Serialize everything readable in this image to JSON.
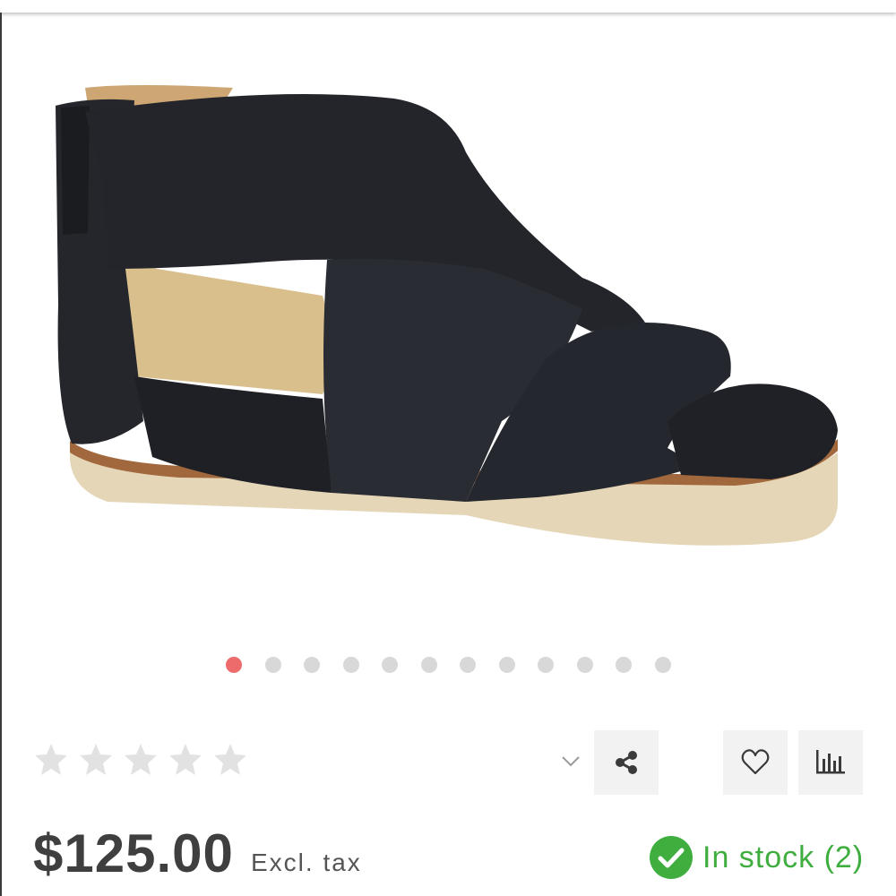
{
  "gallery": {
    "image_alt": "sandal-product-photo",
    "dot_count": 12,
    "active_index": 0,
    "active_color": "#ee6b6b",
    "inactive_color": "#d8d8d8"
  },
  "rating": {
    "stars": 0,
    "max": 5,
    "star_color": "#e2e2e2"
  },
  "actions": {
    "dropdown_icon": "chevron-down-icon",
    "share_icon": "share-icon",
    "wishlist_icon": "heart-icon",
    "compare_icon": "bar-chart-icon"
  },
  "price": {
    "amount": "$125.00",
    "tax_note": "Excl. tax"
  },
  "stock": {
    "text": "In stock (2)",
    "color": "#3fae3f",
    "icon": "check-circle-icon"
  }
}
